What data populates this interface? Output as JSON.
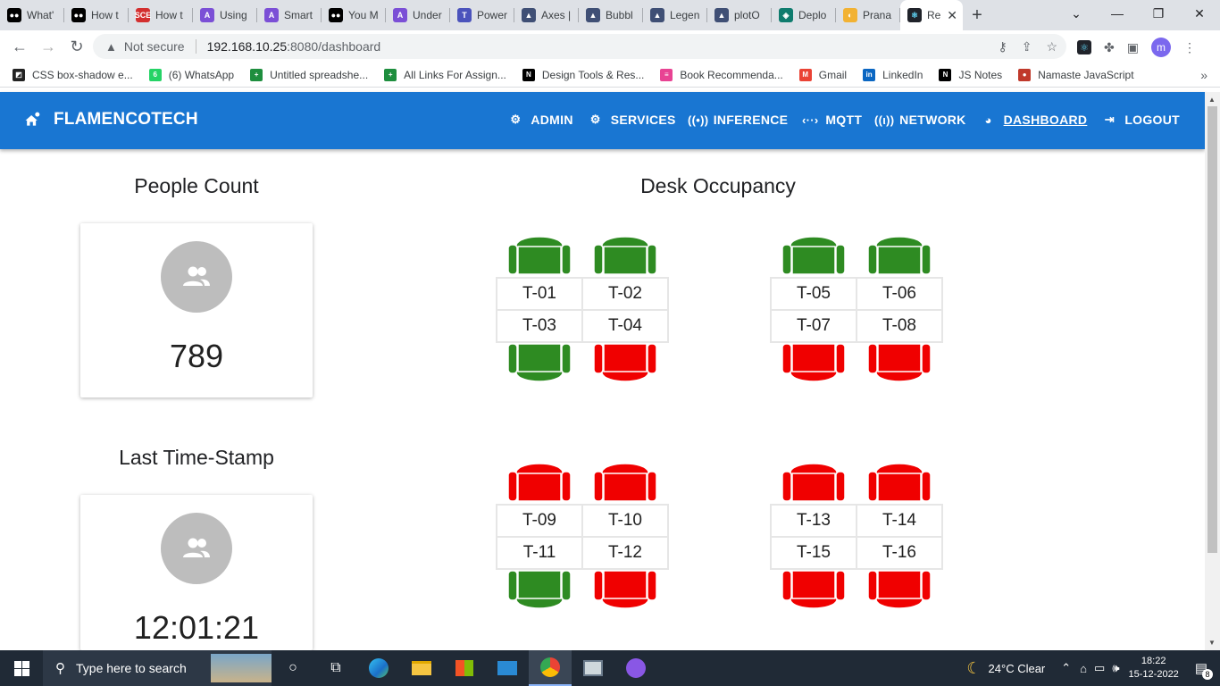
{
  "browser": {
    "tabs": [
      {
        "label": "What'",
        "fav_color": "#000000",
        "fav_char": "●●"
      },
      {
        "label": "How t",
        "fav_color": "#000000",
        "fav_char": "●●"
      },
      {
        "label": "How t",
        "fav_color": "#d32f2f",
        "fav_char": "SCE"
      },
      {
        "label": "Using",
        "fav_color": "#7b4fd6",
        "fav_char": "A"
      },
      {
        "label": "Smart",
        "fav_color": "#7b4fd6",
        "fav_char": "A"
      },
      {
        "label": "You M",
        "fav_color": "#000000",
        "fav_char": "●●"
      },
      {
        "label": "Under",
        "fav_color": "#7b4fd6",
        "fav_char": "A"
      },
      {
        "label": "Power",
        "fav_color": "#4b53bc",
        "fav_char": "T"
      },
      {
        "label": "Axes |",
        "fav_color": "#3f4f75",
        "fav_char": "▲"
      },
      {
        "label": "Bubbl",
        "fav_color": "#3f4f75",
        "fav_char": "▲"
      },
      {
        "label": "Legen",
        "fav_color": "#3f4f75",
        "fav_char": "▲"
      },
      {
        "label": "plotO",
        "fav_color": "#3f4f75",
        "fav_char": "▲"
      },
      {
        "label": "Deplo",
        "fav_color": "#0f7c6e",
        "fav_char": "◈"
      },
      {
        "label": "Prana",
        "fav_color": "#f2b233",
        "fav_char": "◐"
      }
    ],
    "active_tab": {
      "label": "Re",
      "fav_color": "#20232a",
      "fav_char": "⚛"
    },
    "new_tab": "+",
    "address": {
      "warning": "Not secure",
      "host": "192.168.10.25",
      "path": ":8080/dashboard"
    },
    "profile_initial": "m",
    "bookmarks": [
      {
        "label": "CSS box-shadow e...",
        "color": "#222222",
        "char": "◩"
      },
      {
        "label": "(6) WhatsApp",
        "color": "#25d366",
        "char": "6"
      },
      {
        "label": "Untitled spreadshe...",
        "color": "#1e8e3e",
        "char": "+"
      },
      {
        "label": "All Links For Assign...",
        "color": "#1e8e3e",
        "char": "+"
      },
      {
        "label": "Design Tools & Res...",
        "color": "#000000",
        "char": "N"
      },
      {
        "label": "Book Recommenda...",
        "color": "#e84393",
        "char": "≡"
      },
      {
        "label": "Gmail",
        "color": "#ea4335",
        "char": "M"
      },
      {
        "label": "LinkedIn",
        "color": "#0a66c2",
        "char": "in"
      },
      {
        "label": "JS Notes",
        "color": "#000000",
        "char": "N"
      },
      {
        "label": "Namaste JavaScript",
        "color": "#c0392b",
        "char": "●"
      }
    ],
    "bookmarks_more": "»"
  },
  "app": {
    "brand": "FLAMENCOTECH",
    "nav": [
      {
        "label": "ADMIN",
        "icon": "admin-icon",
        "glyph": "⚙"
      },
      {
        "label": "SERVICES",
        "icon": "services-icon",
        "glyph": "⚙"
      },
      {
        "label": "INFERENCE",
        "icon": "inference-icon",
        "glyph": "((•))"
      },
      {
        "label": "MQTT",
        "icon": "mqtt-icon",
        "glyph": "‹··›"
      },
      {
        "label": "NETWORK",
        "icon": "network-icon",
        "glyph": "((ι))"
      },
      {
        "label": "DASHBOARD",
        "icon": "dashboard-icon",
        "glyph": "◕",
        "active": true
      },
      {
        "label": "LOGOUT",
        "icon": "logout-icon",
        "glyph": "⇥"
      }
    ]
  },
  "dashboard": {
    "people_count": {
      "title": "People Count",
      "value": "789"
    },
    "last_timestamp": {
      "title": "Last Time-Stamp",
      "value": "12:01:21"
    },
    "desk_occupancy": {
      "title": "Desk Occupancy",
      "colors": {
        "free": "#2e8b22",
        "occupied": "#f00000"
      },
      "groups": [
        {
          "desks": [
            {
              "id": "T-01",
              "occupied": false
            },
            {
              "id": "T-02",
              "occupied": false
            },
            {
              "id": "T-03",
              "occupied": false
            },
            {
              "id": "T-04",
              "occupied": true
            }
          ]
        },
        {
          "desks": [
            {
              "id": "T-05",
              "occupied": false
            },
            {
              "id": "T-06",
              "occupied": false
            },
            {
              "id": "T-07",
              "occupied": true
            },
            {
              "id": "T-08",
              "occupied": true
            }
          ]
        },
        {
          "desks": [
            {
              "id": "T-09",
              "occupied": true
            },
            {
              "id": "T-10",
              "occupied": true
            },
            {
              "id": "T-11",
              "occupied": false
            },
            {
              "id": "T-12",
              "occupied": true
            }
          ]
        },
        {
          "desks": [
            {
              "id": "T-13",
              "occupied": true
            },
            {
              "id": "T-14",
              "occupied": true
            },
            {
              "id": "T-15",
              "occupied": true
            },
            {
              "id": "T-16",
              "occupied": true
            }
          ]
        }
      ]
    }
  },
  "taskbar": {
    "search_placeholder": "Type here to search",
    "weather": "24°C  Clear",
    "time": "18:22",
    "date": "15-12-2022",
    "notifications": "8"
  }
}
